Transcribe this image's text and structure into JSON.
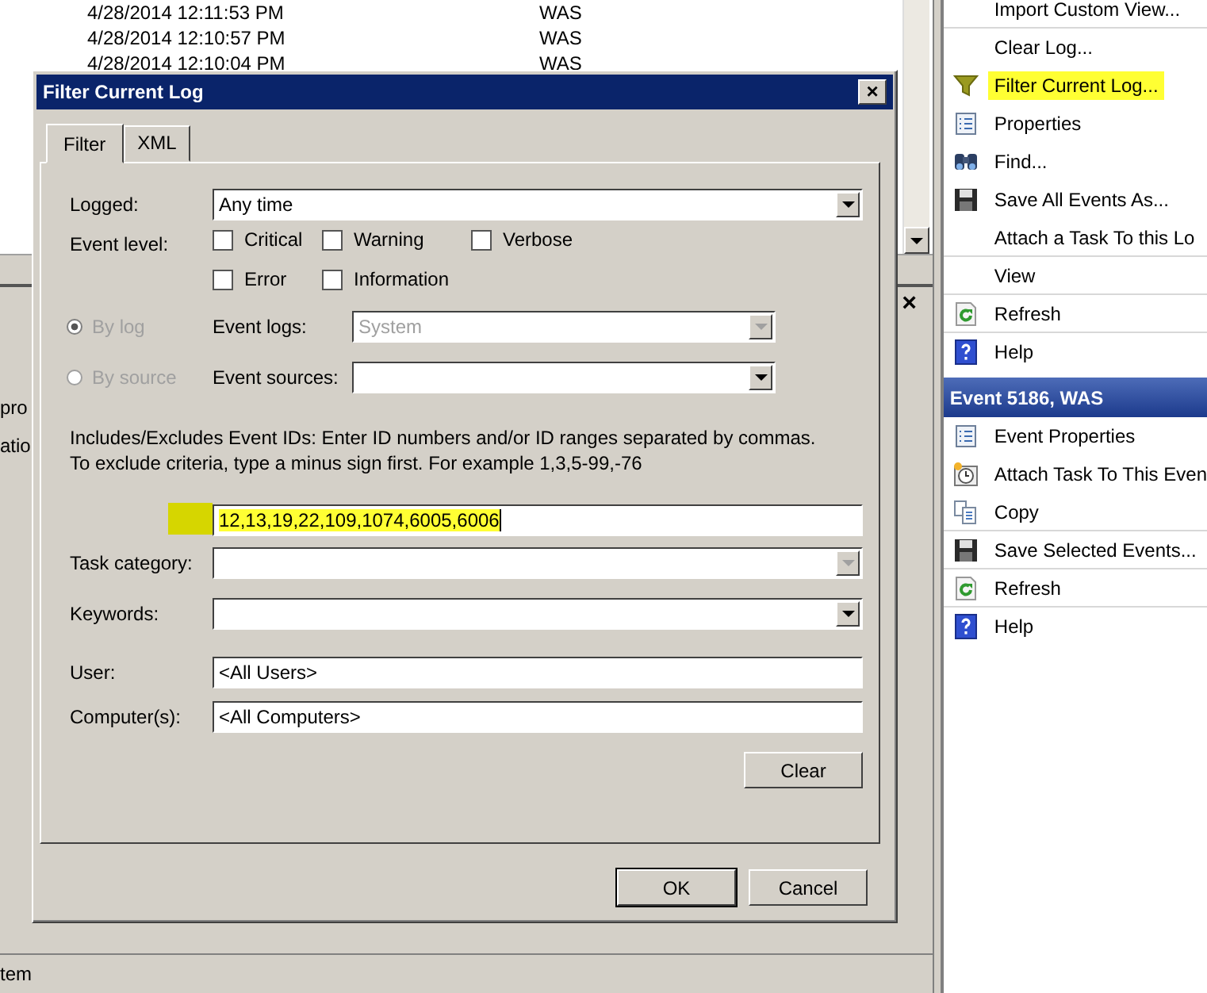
{
  "event_list": {
    "rows": [
      {
        "date": "4/28/2014 12:11:53 PM",
        "source": "WAS"
      },
      {
        "date": "4/28/2014 12:10:57 PM",
        "source": "WAS"
      },
      {
        "date": "4/28/2014 12:10:04 PM",
        "source": "WAS"
      }
    ]
  },
  "details_pane": {
    "close": "×",
    "fragments": [
      "pro",
      "atio"
    ],
    "status_fragment": "tem"
  },
  "actions": {
    "items": [
      {
        "label": "Import Custom View...",
        "kind": "none",
        "highlighted": false,
        "separator_after": true
      },
      {
        "label": "Clear Log...",
        "kind": "none",
        "highlighted": false,
        "separator_after": false
      },
      {
        "label": "Filter Current Log...",
        "kind": "filter",
        "highlighted": true,
        "separator_after": false
      },
      {
        "label": "Properties",
        "kind": "properties",
        "highlighted": false,
        "separator_after": false
      },
      {
        "label": "Find...",
        "kind": "find",
        "highlighted": false,
        "separator_after": false
      },
      {
        "label": "Save All Events As...",
        "kind": "save",
        "highlighted": false,
        "separator_after": false
      },
      {
        "label": "Attach a Task To this Lo",
        "kind": "none",
        "highlighted": false,
        "separator_after": true
      },
      {
        "label": "View",
        "kind": "none",
        "highlighted": false,
        "separator_after": true
      },
      {
        "label": "Refresh",
        "kind": "refresh",
        "highlighted": false,
        "separator_after": true
      },
      {
        "label": "Help",
        "kind": "help",
        "highlighted": false,
        "separator_after": false
      }
    ],
    "selected_event": {
      "header": "Event 5186, WAS",
      "items": [
        {
          "label": "Event Properties",
          "kind": "properties",
          "highlighted": false,
          "separator_after": false
        },
        {
          "label": "Attach Task To This Even",
          "kind": "attach",
          "highlighted": false,
          "separator_after": false
        },
        {
          "label": "Copy",
          "kind": "copy",
          "highlighted": false,
          "separator_after": true
        },
        {
          "label": "Save Selected Events...",
          "kind": "save",
          "highlighted": false,
          "separator_after": true
        },
        {
          "label": "Refresh",
          "kind": "refresh",
          "highlighted": false,
          "separator_after": true
        },
        {
          "label": "Help",
          "kind": "help",
          "highlighted": false,
          "separator_after": false
        }
      ]
    }
  },
  "dialog": {
    "title": "Filter Current Log",
    "close": "×",
    "tabs": [
      {
        "label": "Filter",
        "selected": true
      },
      {
        "label": "XML",
        "selected": false
      }
    ],
    "logged": {
      "label": "Logged:",
      "value": "Any time"
    },
    "event_level": {
      "label": "Event level:",
      "levels": [
        {
          "label": "Critical",
          "checked": false
        },
        {
          "label": "Warning",
          "checked": false
        },
        {
          "label": "Verbose",
          "checked": false
        },
        {
          "label": "Error",
          "checked": false
        },
        {
          "label": "Information",
          "checked": false
        }
      ]
    },
    "sources": [
      {
        "radio": "By log",
        "selected": true,
        "disabled": true,
        "label": "Event logs:",
        "value": "System",
        "field_disabled": true
      },
      {
        "radio": "By source",
        "selected": false,
        "disabled": true,
        "label": "Event sources:",
        "field_disabled": false
      }
    ],
    "ids_help": "Includes/Excludes Event IDs: Enter ID numbers and/or ID ranges separated by commas. To exclude criteria, type a minus sign first. For example 1,3,5-99,-76",
    "event_ids": {
      "value": "12,13,19,22,109,1074,6005,6006",
      "highlighted": true
    },
    "task_category": {
      "label": "Task category:",
      "disabled": true
    },
    "keywords": {
      "label": "Keywords:",
      "disabled": false
    },
    "user": {
      "label": "User:",
      "value": "<All Users>"
    },
    "computers": {
      "label": "Computer(s):",
      "value": "<All Computers>"
    },
    "clear": "Clear",
    "ok": "OK",
    "cancel": "Cancel"
  }
}
